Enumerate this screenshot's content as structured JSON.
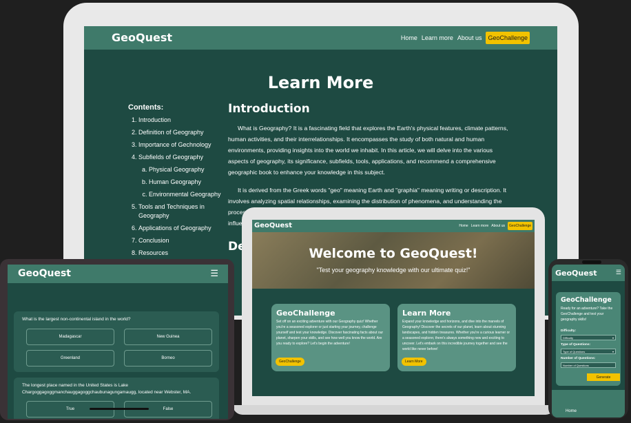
{
  "colors": {
    "theme_bg": "#1e4a42",
    "nav_bg": "#3f7a6a",
    "accent": "#f2c200",
    "card_bg": "#5a9383"
  },
  "desktop": {
    "brand": "GeoQuest",
    "nav": [
      "Home",
      "Learn more",
      "About us"
    ],
    "cta": "GeoChallenge",
    "title": "Learn More",
    "toc_heading": "Contents:",
    "toc": [
      "Introduction",
      "Definition of Geography",
      "Importance of Gechnology",
      "Subfields of Geography",
      "Tools and Techniques in Geography",
      "Applications of Geography",
      "Conclusion",
      "Resources"
    ],
    "toc_sub": [
      "Physical Geography",
      "Human Geography",
      "Environmental Geography"
    ],
    "intro_heading": "Introduction",
    "p1": "What is Geography? It is a fascinating field that explores the Earth's physical features, climate patterns, human activities, and their interrelationships. It encompasses the study of both natural and human environments, providing insights into the world we inhabit. In this article, we will delve into the various aspects of geography, its significance, subfields, tools, applications, and recommend a comprehensive geographic book to enhance your knowledge in this subject.",
    "p2": "It is derived from the Greek words \"geo\" meaning Earth and \"graphia\" meaning writing or description. It involves analyzing spatial relationships, examining the distribution of phenomena, and understanding the processes that shape our planet. Through geography, we gain insights into how natural and human factors influence",
    "def_heading": "De"
  },
  "laptop": {
    "brand": "GeoQuest",
    "nav": [
      "Home",
      "Learn more",
      "About us"
    ],
    "cta": "GeoChallenge",
    "hero_title": "Welcome to GeoQuest!",
    "hero_sub": "\"Test your geography knowledge with our ultimate quiz!\"",
    "card1_title": "GeoChallenge",
    "card1_text": "Set off on an exciting adventure with our Geography quiz! Whether you're a seasoned explorer or just starting your journey, challenge yourself and test your knowledge. Discover fascinating facts about our planet, sharpen your skills, and see how well you know the world. Are you ready to explore? Let's begin the adventure!",
    "card1_btn": "GeoChallenge",
    "card2_title": "Learn More",
    "card2_text": "Expand your knowledge and horizons, and dive into the marvels of Geography! Discover the secrets of our planet, learn about stunning landscapes, and hidden treasures. Whether you're a curious learner or a seasoned explorer, there's always something new and exciting to uncover. Let's embark on this incredible journey together and see the world like never before!",
    "card2_btn": "Learn More"
  },
  "tablet": {
    "brand": "GeoQuest",
    "q1": "What is the largest non-continental island in the world?",
    "q1_options": [
      "Madagascar",
      "New Guinea",
      "Greenland",
      "Borneo"
    ],
    "q2": "The longest place named in the United States is Lake Chargoggagoggmanchauggagoggchaubunagungamaugg, located near Webster, MA.",
    "q2_options": [
      "True",
      "False"
    ]
  },
  "phone": {
    "brand": "GeoQuest",
    "card_title": "GeoChallenge",
    "card_text": "Ready for an adventure? Take the GeoChallenge and test your geography skills!",
    "difficulty_label": "Difficulty:",
    "difficulty_value": "Difficulty",
    "type_label": "Type of Questions:",
    "type_value": "Type of Questions",
    "num_label": "Number of Questions:",
    "num_placeholder": "Number of Questions",
    "generate": "Generate",
    "footer_home": "Home"
  }
}
